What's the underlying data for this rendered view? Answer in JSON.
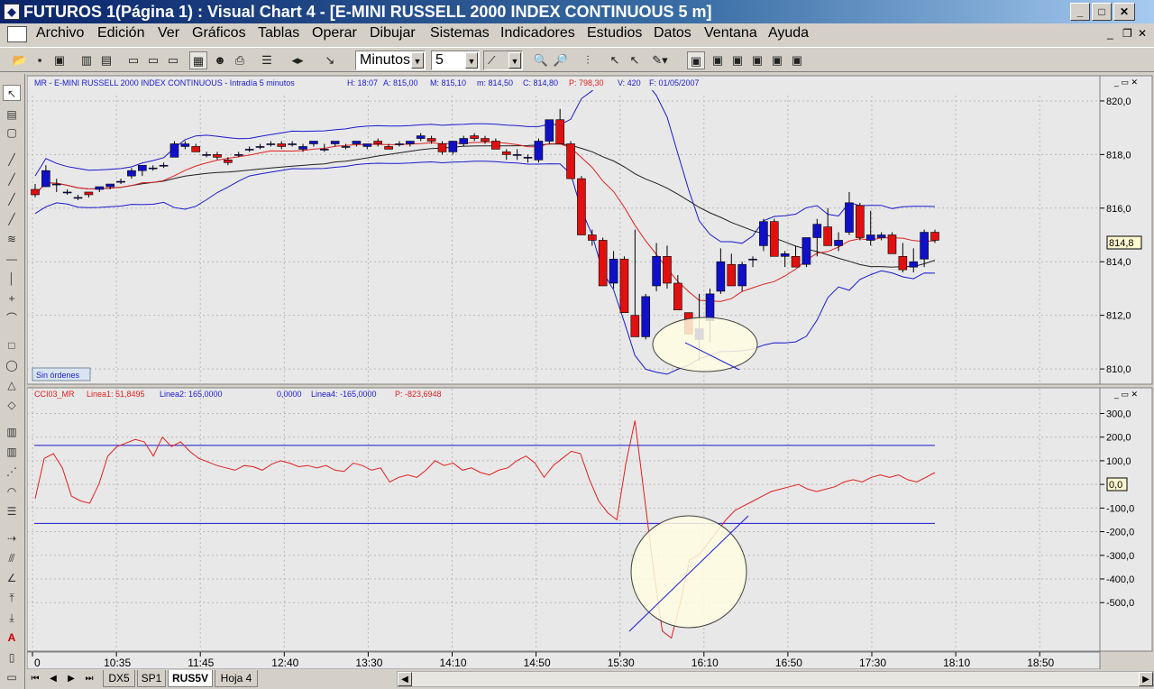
{
  "window": {
    "title": "FUTUROS 1(Página 1) : Visual Chart 4 - [E-MINI RUSSELL 2000 INDEX CONTINUOUS 5 m]"
  },
  "menu": [
    "Archivo",
    "Edición",
    "Ver",
    "Gráficos",
    "Tablas",
    "Operar",
    "Dibujar",
    "Sistemas",
    "Indicadores",
    "Estudios",
    "Datos",
    "Ventana",
    "Ayuda"
  ],
  "toolbar": {
    "period_unit": "Minutos",
    "period_value": "5"
  },
  "price_panel": {
    "header": {
      "symbol": "MR - E-MINI RUSSELL 2000 INDEX CONTINUOUS - Intradía 5 minutos",
      "high": "H: 18:07",
      "ask": "A: 815,00",
      "max": "M: 815,10",
      "min": "m: 814,50",
      "close": "C: 814,80",
      "p_label": "P: 798,30",
      "volume": "V: 420",
      "date": "F: 01/05/2007"
    },
    "orders_label": "Sin órdenes",
    "last_price": "814,8",
    "y_ticks": [
      "820,0",
      "818,0",
      "816,0",
      "814,0",
      "812,0",
      "810,0"
    ],
    "colors": {
      "up": "#1010c8",
      "down": "#e01010",
      "bollinger": "#1a1ad0",
      "ma_red": "#e02020",
      "ma_black": "#202020"
    }
  },
  "cci_panel": {
    "header": {
      "name": "CCI03_MR",
      "linea1": "Linea1: 51,8495",
      "linea2": "Linea2: 165,0000",
      "linea3": "0,0000",
      "linea4": "Linea4: -165,0000",
      "p": "P: -823,6948"
    },
    "last_value": "0,0",
    "y_ticks": [
      "300,0",
      "200,0",
      "100,0",
      "0,0",
      "-100,0",
      "-200,0",
      "-300,0",
      "-400,0",
      "-500,0"
    ]
  },
  "time_axis": {
    "ticks": [
      "0",
      "10:35",
      "11:45",
      "12:40",
      "13:30",
      "14:10",
      "14:50",
      "15:30",
      "16:10",
      "16:50",
      "17:30",
      "18:10",
      "18:50"
    ]
  },
  "sheets": {
    "tabs": [
      "DX5",
      "SP1",
      "RUS5V",
      "Hoja 4"
    ],
    "active": "RUS5V"
  },
  "chart_data": {
    "type": "candlestick",
    "ohlc": [
      [
        816.7,
        816.9,
        816.4,
        816.5
      ],
      [
        816.8,
        817.6,
        816.8,
        817.4
      ],
      [
        816.9,
        817.1,
        816.6,
        816.9
      ],
      [
        816.6,
        816.7,
        816.5,
        816.6
      ],
      [
        816.4,
        816.5,
        816.3,
        816.4
      ],
      [
        816.6,
        816.6,
        816.4,
        816.5
      ],
      [
        816.7,
        816.8,
        816.6,
        816.8
      ],
      [
        816.8,
        816.9,
        816.7,
        816.9
      ],
      [
        817.0,
        817.1,
        816.9,
        817.0
      ],
      [
        817.2,
        817.5,
        817.1,
        817.4
      ],
      [
        817.4,
        817.6,
        817.2,
        817.6
      ],
      [
        817.5,
        817.6,
        817.4,
        817.5
      ],
      [
        817.6,
        817.7,
        817.5,
        817.6
      ],
      [
        817.9,
        818.5,
        817.9,
        818.4
      ],
      [
        818.3,
        818.5,
        818.2,
        818.4
      ],
      [
        818.3,
        818.4,
        818.1,
        818.1
      ],
      [
        818.0,
        818.1,
        817.9,
        818.0
      ],
      [
        818.0,
        818.1,
        817.8,
        817.9
      ],
      [
        817.8,
        817.9,
        817.6,
        817.7
      ],
      [
        818.0,
        818.1,
        817.9,
        818.0
      ],
      [
        818.2,
        818.3,
        818.1,
        818.2
      ],
      [
        818.3,
        818.4,
        818.2,
        818.3
      ],
      [
        818.4,
        818.5,
        818.3,
        818.4
      ],
      [
        818.4,
        818.5,
        818.2,
        818.3
      ],
      [
        818.4,
        818.5,
        818.3,
        818.4
      ],
      [
        818.2,
        818.4,
        818.1,
        818.3
      ],
      [
        818.4,
        818.5,
        818.3,
        818.5
      ],
      [
        818.2,
        818.4,
        818.1,
        818.2
      ],
      [
        818.4,
        818.5,
        818.3,
        818.5
      ],
      [
        818.3,
        818.4,
        818.2,
        818.3
      ],
      [
        818.4,
        818.5,
        818.3,
        818.5
      ],
      [
        818.3,
        818.4,
        818.2,
        818.4
      ],
      [
        818.5,
        818.6,
        818.3,
        818.4
      ],
      [
        818.3,
        818.4,
        818.2,
        818.2
      ],
      [
        818.4,
        818.5,
        818.3,
        818.4
      ],
      [
        818.4,
        818.5,
        818.3,
        818.5
      ],
      [
        818.6,
        818.8,
        818.5,
        818.7
      ],
      [
        818.6,
        818.7,
        818.4,
        818.5
      ],
      [
        818.4,
        818.5,
        818.0,
        818.1
      ],
      [
        818.1,
        818.5,
        818.0,
        818.5
      ],
      [
        818.4,
        818.7,
        818.3,
        818.6
      ],
      [
        818.7,
        818.8,
        818.5,
        818.6
      ],
      [
        818.6,
        818.7,
        818.4,
        818.5
      ],
      [
        818.5,
        818.6,
        818.2,
        818.2
      ],
      [
        818.1,
        818.2,
        817.8,
        818.0
      ],
      [
        818.0,
        818.2,
        817.8,
        818.0
      ],
      [
        817.9,
        818.0,
        817.7,
        817.9
      ],
      [
        817.8,
        818.6,
        817.7,
        818.5
      ],
      [
        818.5,
        819.2,
        818.4,
        819.3
      ],
      [
        819.3,
        819.7,
        818.4,
        818.4
      ],
      [
        818.4,
        818.5,
        817.1,
        817.1
      ],
      [
        817.1,
        817.2,
        815.0,
        815.0
      ],
      [
        815.0,
        815.2,
        814.6,
        814.8
      ],
      [
        814.8,
        814.9,
        813.1,
        813.1
      ],
      [
        813.2,
        814.4,
        813.0,
        814.1
      ],
      [
        814.1,
        814.2,
        812.1,
        812.1
      ],
      [
        812.0,
        815.2,
        811.2,
        811.2
      ],
      [
        811.2,
        812.8,
        811.1,
        812.7
      ],
      [
        813.1,
        814.7,
        812.9,
        814.2
      ],
      [
        814.2,
        814.6,
        813.0,
        813.2
      ],
      [
        813.2,
        813.5,
        812.2,
        812.2
      ],
      [
        812.1,
        812.1,
        811.3,
        811.3
      ],
      [
        811.1,
        812.8,
        810.3,
        811.5
      ],
      [
        811.8,
        813.0,
        811.0,
        812.8
      ],
      [
        812.9,
        814.5,
        812.8,
        814.0
      ],
      [
        813.9,
        814.3,
        813.2,
        813.1
      ],
      [
        813.1,
        814.0,
        812.9,
        813.9
      ],
      [
        814.1,
        814.2,
        813.8,
        814.1
      ],
      [
        814.6,
        815.6,
        814.4,
        815.5
      ],
      [
        815.5,
        815.6,
        814.3,
        814.2
      ],
      [
        814.2,
        814.4,
        813.8,
        814.3
      ],
      [
        814.2,
        814.6,
        813.9,
        813.8
      ],
      [
        813.9,
        814.7,
        813.8,
        814.9
      ],
      [
        814.9,
        815.6,
        814.2,
        815.4
      ],
      [
        815.3,
        816.0,
        814.7,
        814.6
      ],
      [
        814.6,
        815.1,
        814.4,
        814.8
      ],
      [
        815.1,
        816.6,
        815.0,
        816.2
      ],
      [
        816.1,
        816.2,
        814.8,
        814.9
      ],
      [
        814.8,
        815.9,
        814.6,
        815.0
      ],
      [
        814.9,
        815.1,
        814.8,
        815.0
      ],
      [
        815.0,
        815.1,
        814.3,
        814.3
      ],
      [
        814.2,
        814.7,
        813.6,
        813.7
      ],
      [
        813.8,
        814.5,
        813.6,
        814.0
      ],
      [
        814.1,
        815.2,
        813.8,
        815.1
      ],
      [
        815.1,
        815.2,
        814.7,
        814.8
      ]
    ],
    "cci": [
      -60,
      110,
      130,
      70,
      -50,
      -70,
      -80,
      0,
      120,
      160,
      175,
      190,
      180,
      120,
      200,
      160,
      180,
      140,
      110,
      95,
      80,
      70,
      60,
      80,
      75,
      60,
      85,
      100,
      90,
      75,
      80,
      70,
      80,
      60,
      55,
      90,
      80,
      60,
      70,
      10,
      30,
      40,
      30,
      60,
      100,
      80,
      90,
      60,
      70,
      50,
      40,
      60,
      70,
      100,
      120,
      90,
      30,
      80,
      110,
      140,
      130,
      20,
      -70,
      -120,
      -150,
      90,
      270,
      -40,
      -350,
      -620,
      -650,
      -500,
      -320,
      -300,
      -250,
      -200,
      -150,
      -110,
      -90,
      -70,
      -50,
      -30,
      -20,
      -10,
      0,
      -20,
      -30,
      -20,
      -10,
      10,
      20,
      10,
      30,
      40,
      30,
      40,
      20,
      10,
      30,
      50
    ],
    "cci_levels": [
      165,
      -165
    ],
    "y_range_price": [
      809.7,
      820.2
    ],
    "y_range_cci": [
      -690,
      340
    ]
  }
}
